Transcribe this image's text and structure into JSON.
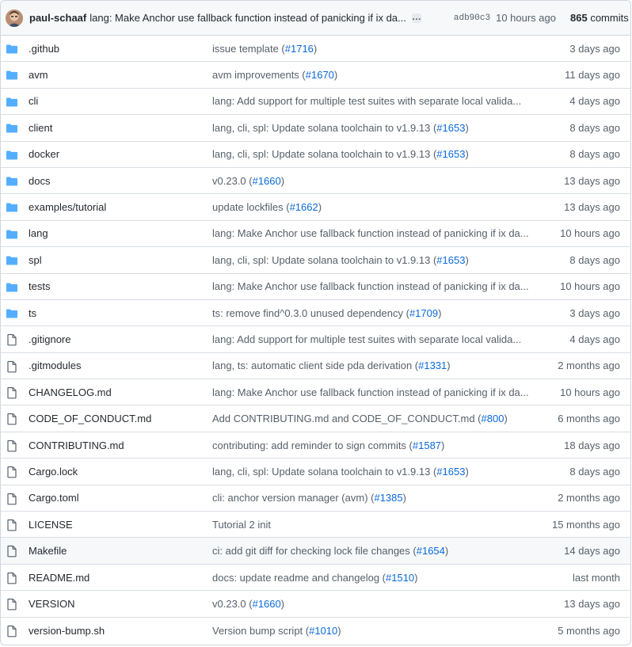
{
  "header": {
    "author": "paul-schaaf",
    "message": "lang: Make Anchor use fallback function instead of panicking if ix da...",
    "ellipsis": "…",
    "sha": "adb90c3",
    "time": "10 hours ago",
    "commit_count": "865",
    "commits_label": "commits"
  },
  "colors": {
    "folder": "#54aeff",
    "file": "#57606a",
    "link": "#0969da",
    "check": "#1a7f37"
  },
  "files": [
    {
      "type": "folder",
      "name": ".github",
      "msg": "issue template (",
      "link": "#1716",
      "msg_end": ")",
      "age": "3 days ago"
    },
    {
      "type": "folder",
      "name": "avm",
      "msg": "avm improvements (",
      "link": "#1670",
      "msg_end": ")",
      "age": "11 days ago"
    },
    {
      "type": "folder",
      "name": "cli",
      "msg": "lang: Add support for multiple test suites with separate local valida...",
      "link": "",
      "msg_end": "",
      "age": "4 days ago"
    },
    {
      "type": "folder",
      "name": "client",
      "msg": "lang, cli, spl: Update solana toolchain to v1.9.13 (",
      "link": "#1653",
      "msg_end": ")",
      "age": "8 days ago"
    },
    {
      "type": "folder",
      "name": "docker",
      "msg": "lang, cli, spl: Update solana toolchain to v1.9.13 (",
      "link": "#1653",
      "msg_end": ")",
      "age": "8 days ago"
    },
    {
      "type": "folder",
      "name": "docs",
      "msg": "v0.23.0 (",
      "link": "#1660",
      "msg_end": ")",
      "age": "13 days ago"
    },
    {
      "type": "folder",
      "name": "examples/tutorial",
      "msg": "update lockfiles (",
      "link": "#1662",
      "msg_end": ")",
      "age": "13 days ago"
    },
    {
      "type": "folder",
      "name": "lang",
      "msg": "lang: Make Anchor use fallback function instead of panicking if ix da...",
      "link": "",
      "msg_end": "",
      "age": "10 hours ago"
    },
    {
      "type": "folder",
      "name": "spl",
      "msg": "lang, cli, spl: Update solana toolchain to v1.9.13 (",
      "link": "#1653",
      "msg_end": ")",
      "age": "8 days ago"
    },
    {
      "type": "folder",
      "name": "tests",
      "msg": "lang: Make Anchor use fallback function instead of panicking if ix da...",
      "link": "",
      "msg_end": "",
      "age": "10 hours ago"
    },
    {
      "type": "folder",
      "name": "ts",
      "msg": "ts: remove find^0.3.0 unused dependency (",
      "link": "#1709",
      "msg_end": ")",
      "age": "3 days ago"
    },
    {
      "type": "file",
      "name": ".gitignore",
      "msg": "lang: Add support for multiple test suites with separate local valida...",
      "link": "",
      "msg_end": "",
      "age": "4 days ago"
    },
    {
      "type": "file",
      "name": ".gitmodules",
      "msg": "lang, ts: automatic client side pda derivation (",
      "link": "#1331",
      "msg_end": ")",
      "age": "2 months ago"
    },
    {
      "type": "file",
      "name": "CHANGELOG.md",
      "msg": "lang: Make Anchor use fallback function instead of panicking if ix da...",
      "link": "",
      "msg_end": "",
      "age": "10 hours ago"
    },
    {
      "type": "file",
      "name": "CODE_OF_CONDUCT.md",
      "msg": "Add CONTRIBUTING.md and CODE_OF_CONDUCT.md (",
      "link": "#800",
      "msg_end": ")",
      "age": "6 months ago"
    },
    {
      "type": "file",
      "name": "CONTRIBUTING.md",
      "msg": "contributing: add reminder to sign commits (",
      "link": "#1587",
      "msg_end": ")",
      "age": "18 days ago"
    },
    {
      "type": "file",
      "name": "Cargo.lock",
      "msg": "lang, cli, spl: Update solana toolchain to v1.9.13 (",
      "link": "#1653",
      "msg_end": ")",
      "age": "8 days ago"
    },
    {
      "type": "file",
      "name": "Cargo.toml",
      "msg": "cli: anchor version manager (avm) (",
      "link": "#1385",
      "msg_end": ")",
      "age": "2 months ago"
    },
    {
      "type": "file",
      "name": "LICENSE",
      "msg": "Tutorial 2 init",
      "link": "",
      "msg_end": "",
      "age": "15 months ago"
    },
    {
      "type": "file",
      "name": "Makefile",
      "msg": "ci: add git diff for checking lock file changes (",
      "link": "#1654",
      "msg_end": ")",
      "age": "14 days ago",
      "highlight": true
    },
    {
      "type": "file",
      "name": "README.md",
      "msg": "docs: update readme and changelog (",
      "link": "#1510",
      "msg_end": ")",
      "age": "last month"
    },
    {
      "type": "file",
      "name": "VERSION",
      "msg": "v0.23.0 (",
      "link": "#1660",
      "msg_end": ")",
      "age": "13 days ago"
    },
    {
      "type": "file",
      "name": "version-bump.sh",
      "msg": "Version bump script (",
      "link": "#1010",
      "msg_end": ")",
      "age": "5 months ago"
    }
  ]
}
